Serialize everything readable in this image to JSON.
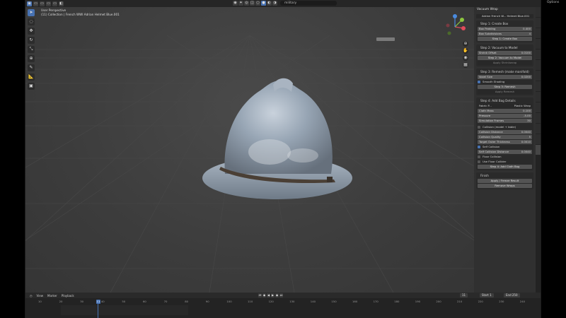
{
  "header": {
    "search_value": "military",
    "options_label": "Options"
  },
  "viewport": {
    "view_name": "User Perspective",
    "collection_line": "(11) Collection | French WWI Adrian Helmet Blue.001"
  },
  "sidebar": {
    "panel_title": "Vacuum Wrap",
    "object_dropdown": "Adrian French W... Helmet Blue.001",
    "step1": {
      "title": "Step 1: Create Box",
      "fields": [
        {
          "label": "Box Padding",
          "value": "0.400"
        },
        {
          "label": "Box Subdivisions",
          "value": "4"
        }
      ],
      "button": "Step 1: Create Box"
    },
    "step2": {
      "title": "Step 2: Vacuum to Model",
      "fields": [
        {
          "label": "Shrink Offset",
          "value": "0.0100"
        }
      ],
      "button": "Step 2: Vacuum to Model",
      "button2": "Apply Shrinkwrap"
    },
    "step3": {
      "title": "Step 3: Remesh (make manifold)",
      "fields": [
        {
          "label": "Voxel Size",
          "value": "0.0200"
        }
      ],
      "checkbox": "Smooth Shading",
      "button": "Step 3: Remesh",
      "button2": "Apply Remesh"
    },
    "step4": {
      "title": "Step 4: Add Bag Details",
      "preset_label": "Fabric P...",
      "preset_value": "Plastic Wrap",
      "fields": [
        {
          "label": "Cloth Mass",
          "value": "0.100"
        },
        {
          "label": "Pressure",
          "value": "-5.00"
        },
        {
          "label": "Simulation Frames",
          "value": "30"
        }
      ],
      "collision_header": "Collision (model + table)",
      "collision_fields": [
        {
          "label": "Collision Distance",
          "value": "0.0040"
        },
        {
          "label": "Collision Quality",
          "value": "5"
        },
        {
          "label": "Target Outer Thickness",
          "value": "0.0010"
        }
      ],
      "self_collision": "Self Collision",
      "self_distance": {
        "label": "Self Collision Distance",
        "value": "0.0040"
      },
      "floor_collision": "Floor Collision",
      "use_floor": "Use Floor Collider",
      "button": "Step 4: Add Cloth Bag"
    },
    "finish": {
      "title": "Finish",
      "apply_button": "Apply / Freeze Result",
      "remove_button": "Remove Wraps"
    }
  },
  "timeline": {
    "menus": [
      "View",
      "Marker"
    ],
    "playback": "Playback",
    "current_frame": "11",
    "start_label": "Start",
    "start_value": "1",
    "end_label": "End",
    "end_value": "250",
    "ruler_ticks": [
      "10",
      "20",
      "30",
      "40",
      "50",
      "60",
      "70",
      "80",
      "90",
      "100",
      "110",
      "120",
      "130",
      "140",
      "150",
      "160",
      "170",
      "180",
      "190",
      "200",
      "210",
      "220",
      "230",
      "240"
    ]
  },
  "icons": {
    "toolbar": [
      "cursor-icon",
      "select-circle-icon",
      "move-icon",
      "rotate-icon",
      "scale-icon",
      "transform-icon",
      "annotate-icon",
      "measure-icon",
      "add-cube-icon"
    ]
  },
  "colors": {
    "accent": "#4772b3",
    "helmet": "#9aa8b8",
    "strap": "#4a3f35"
  }
}
